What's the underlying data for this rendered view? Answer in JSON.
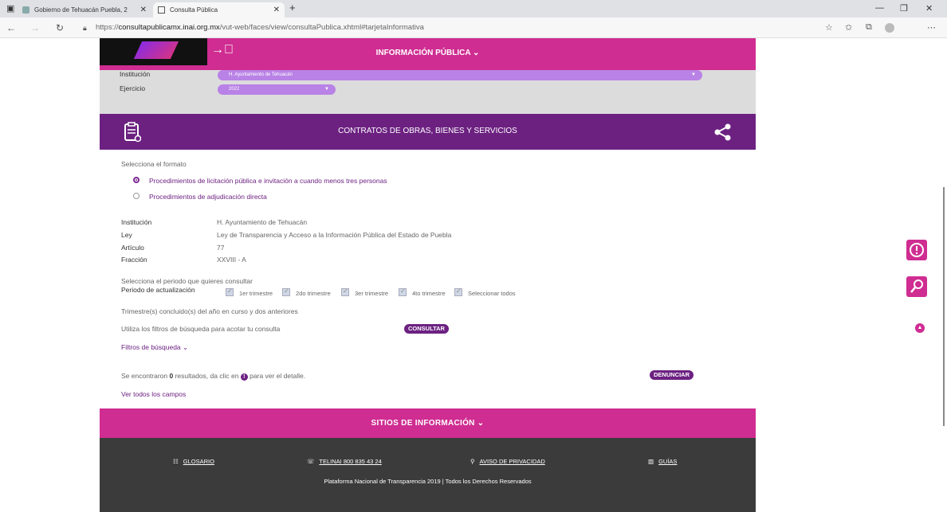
{
  "browser": {
    "tabs": [
      {
        "title": "Gobierno de Tehuacán Puebla, 2"
      },
      {
        "title": "Consulta Pública"
      }
    ],
    "url_prefix": "https://",
    "url_domain": "consultapublicamx.inai.org.mx",
    "url_path": "/vut-web/faces/view/consultaPublica.xhtml#tarjetaInformativa"
  },
  "header": {
    "title": "INFORMACIÓN PÚBLICA ⌄"
  },
  "top_filters": {
    "institucion_label": "Institución",
    "institucion_value": "H. Ayuntamiento de Tehuacán",
    "ejercicio_label": "Ejercicio",
    "ejercicio_value": "2022"
  },
  "band": {
    "title": "CONTRATOS DE OBRAS, BIENES Y SERVICIOS"
  },
  "format": {
    "label": "Selecciona el formato",
    "option1": "Procedimientos de licitación pública e invitación a cuando menos tres personas",
    "option2": "Procedimientos de adjudicación directa"
  },
  "details": {
    "institucion_label": "Institución",
    "institucion_value": "H. Ayuntamiento de Tehuacán",
    "ley_label": "Ley",
    "ley_value": "Ley de Transparencia y Acceso a la Información Pública del Estado de Puebla",
    "articulo_label": "Artículo",
    "articulo_value": "77",
    "fraccion_label": "Fracción",
    "fraccion_value": "XXVIII - A"
  },
  "periodo": {
    "label": "Selecciona el periodo que quieres consultar",
    "sublabel": "Periodo de actualización",
    "options": [
      "1er trimestre",
      "2do trimestre",
      "3er trimestre",
      "4to trimestre",
      "Seleccionar todos"
    ],
    "note": "Trimestre(s) concluido(s) del año en curso y dos anteriores"
  },
  "search": {
    "hint": "Utiliza los filtros de búsqueda para acotar tu consulta",
    "consultar": "CONSULTAR",
    "filtros": "Filtros de búsqueda ⌄"
  },
  "results": {
    "prefix": "Se encontraron ",
    "count": "0",
    "middle": " resultados, da clic en ",
    "suffix": " para ver el detalle.",
    "denunciar": "DENUNCIAR",
    "ver_todos": "Ver todos los campos"
  },
  "footer": {
    "sitios": "SITIOS DE INFORMACIÓN ⌄",
    "glosario": "GLOSARIO",
    "telinai": "TELINAI 800 835 43 24",
    "aviso": "AVISO DE PRIVACIDAD",
    "guias": "GUÍAS",
    "copyright": "Plataforma Nacional de Transparencia 2019 | Todos los Derechos Reservados"
  }
}
